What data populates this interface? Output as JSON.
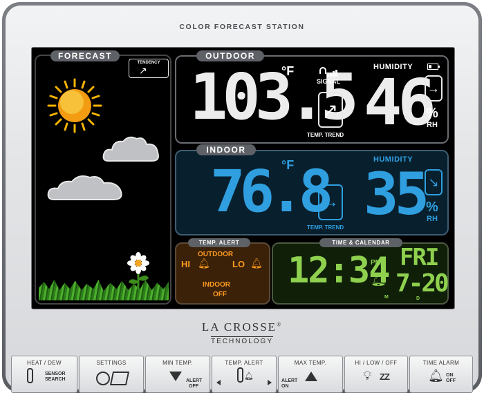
{
  "device_title": "COLOR FORECAST STATION",
  "forecast": {
    "label": "FORECAST",
    "tendency_label": "TENDENCY"
  },
  "outdoor": {
    "label": "OUTDOOR",
    "temp": "103.5",
    "temp_unit": "°F",
    "signal_label": "SIGNAL",
    "trend_label": "TEMP. TREND",
    "humidity_label": "HUMIDITY",
    "humidity": "46",
    "humidity_unit": "%",
    "rh_label": "RH"
  },
  "indoor": {
    "label": "INDOOR",
    "temp": "76.8",
    "temp_unit": "°F",
    "trend_label": "TEMP. TREND",
    "humidity_label": "HUMIDITY",
    "humidity": "35",
    "humidity_unit": "%",
    "rh_label": "RH"
  },
  "temp_alert": {
    "label": "TEMP. ALERT",
    "outdoor": "OUTDOOR",
    "hi": "HI",
    "lo": "LO",
    "indoor": "INDOOR",
    "indoor_state": "OFF"
  },
  "time_calendar": {
    "label": "TIME & CALENDAR",
    "time": "12:34",
    "ampm": "PM",
    "day": "FRI",
    "date": "7-20",
    "m": "M",
    "d": "D"
  },
  "brand": {
    "line1": "LA CROSSE",
    "reg": "®",
    "line2": "TECHNOLOGY"
  },
  "buttons": [
    {
      "title": "HEAT / DEW",
      "sub1": "SENSOR",
      "sub2": "SEARCH"
    },
    {
      "title": "SETTINGS"
    },
    {
      "title": "MIN TEMP.",
      "sub1": "ALERT",
      "sub2": "OFF"
    },
    {
      "title": "TEMP. ALERT"
    },
    {
      "title": "MAX TEMP.",
      "sub1": "ALERT",
      "sub2": "ON"
    },
    {
      "title": "HI / LOW / OFF",
      "sub1": "ZZ"
    },
    {
      "title": "TIME ALARM",
      "sub1": "ON",
      "sub2": "OFF"
    }
  ],
  "colors": {
    "outdoor_digits": "#ececec",
    "indoor_digits": "#2f9fe0",
    "time_digits": "#8fd14f",
    "alert_text": "#ff9a1e"
  }
}
